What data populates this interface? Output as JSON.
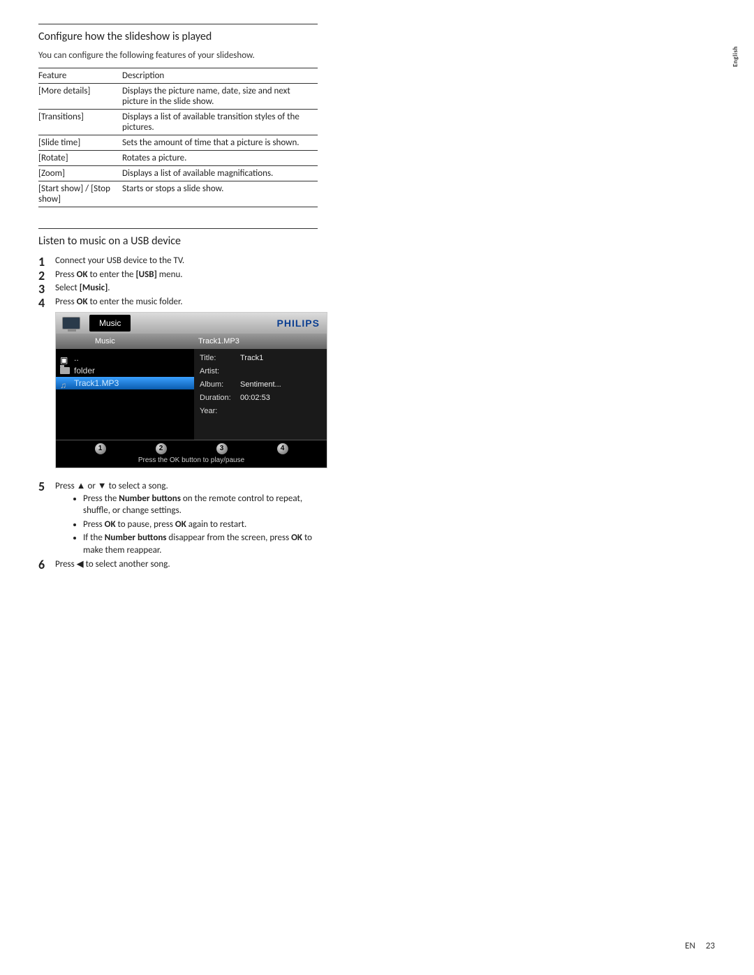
{
  "side_tab": "English",
  "section1": {
    "title": "Configure how the slideshow is played",
    "intro": "You can configure the following features of your slideshow.",
    "table": {
      "head_feature": "Feature",
      "head_description": "Description",
      "rows": [
        {
          "feature": "[More details]",
          "desc": "Displays the picture name, date, size and next picture in the slide show."
        },
        {
          "feature": "[Transitions]",
          "desc": "Displays a list of available transition styles of the pictures."
        },
        {
          "feature": "[Slide time]",
          "desc": "Sets the amount of time that a picture is shown."
        },
        {
          "feature": "[Rotate]",
          "desc": "Rotates a picture."
        },
        {
          "feature": "[Zoom]",
          "desc": "Displays a list of available magnifications."
        },
        {
          "feature": "[Start show] / [Stop show]",
          "desc": "Starts or stops a slide show."
        }
      ]
    }
  },
  "section2": {
    "title": "Listen to music on a USB device",
    "steps": {
      "s1": "Connect your USB device to the TV.",
      "s2_pre": "Press ",
      "s2_ok": "OK",
      "s2_mid": " to enter the ",
      "s2_usb": "[USB]",
      "s2_post": " menu.",
      "s3_pre": "Select ",
      "s3_music": "[Music]",
      "s3_post": ".",
      "s4_pre": "Press ",
      "s4_ok": "OK",
      "s4_post": " to enter the music folder.",
      "s5_pre": "Press ",
      "s5_up": "▲",
      "s5_or": " or ",
      "s5_down": "▼",
      "s5_post": " to select a song.",
      "b1_pre": "Press the ",
      "b1_bold": "Number buttons",
      "b1_post": " on the remote control to repeat, shuffle, or change settings.",
      "b2_pre": "Press ",
      "b2_ok1": "OK",
      "b2_mid": " to pause, press ",
      "b2_ok2": "OK",
      "b2_post": " again to restart.",
      "b3_pre": "If the ",
      "b3_bold": "Number buttons",
      "b3_mid": " disappear from the screen, press ",
      "b3_ok": "OK",
      "b3_post": " to make them reappear.",
      "s6_pre": "Press ",
      "s6_left": "◀",
      "s6_post": " to select another song."
    }
  },
  "osd": {
    "brand": "PHILIPS",
    "top_title": "Music",
    "sub_left": "Music",
    "sub_right": "Track1.MP3",
    "list": {
      "up": "..",
      "folder": "folder",
      "track": "Track1.MP3"
    },
    "info": {
      "title_k": "Title:",
      "title_v": "Track1",
      "artist_k": "Artist:",
      "artist_v": "",
      "album_k": "Album:",
      "album_v": "Sentiment...",
      "dur_k": "Duration:",
      "dur_v": "00:02:53",
      "year_k": "Year:",
      "year_v": ""
    },
    "dots": {
      "d1": "1",
      "d2": "2",
      "d3": "3",
      "d4": "4"
    },
    "hint": "Press the OK button to play/pause"
  },
  "footer": {
    "lang": "EN",
    "page": "23"
  }
}
